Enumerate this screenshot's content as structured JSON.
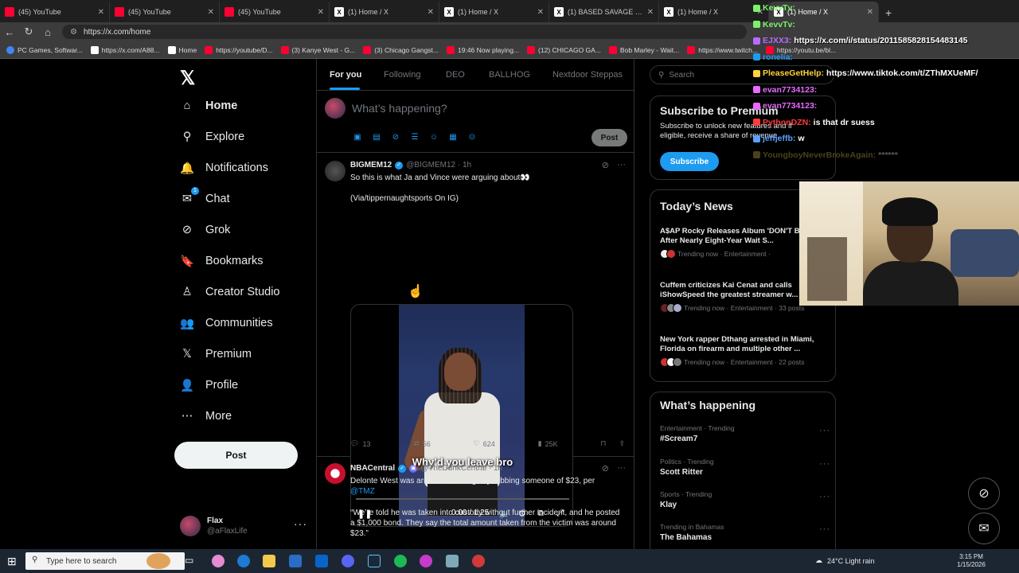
{
  "browser": {
    "tabs": [
      {
        "title": "(45) YouTube",
        "type": "yt"
      },
      {
        "title": "(45) YouTube",
        "type": "yt"
      },
      {
        "title": "(45) YouTube",
        "type": "yt"
      },
      {
        "title": "(1) Home / X",
        "type": "x"
      },
      {
        "title": "(1) Home / X",
        "type": "x"
      },
      {
        "title": "(1) BASED SAVAGE on X: \"T",
        "type": "x"
      },
      {
        "title": "(1) Home / X",
        "type": "x"
      },
      {
        "title": "(1) Home / X",
        "type": "x"
      }
    ],
    "url": "https://x.com/home",
    "bookmarks": [
      "PC Games, Softwar...",
      "https://x.com/A88...",
      "Home",
      "https://youtube/D...",
      "(3) Kanye West - G...",
      "(3) Chicago Gangst...",
      "19:46 Now playing...",
      "(12) CHICAGO GA...",
      "Bob Marley - Wait...",
      "https://www.twitch...",
      "https://youtu.be/bl..."
    ]
  },
  "nav": {
    "items": [
      {
        "label": "Home",
        "icon": "home-icon",
        "glyph": "⌂"
      },
      {
        "label": "Explore",
        "icon": "search-icon",
        "glyph": "⚲"
      },
      {
        "label": "Notifications",
        "icon": "bell-icon",
        "glyph": "🔔"
      },
      {
        "label": "Chat",
        "icon": "mail-icon",
        "glyph": "✉",
        "badge": "1"
      },
      {
        "label": "Grok",
        "icon": "grok-icon",
        "glyph": "⊘"
      },
      {
        "label": "Bookmarks",
        "icon": "bookmark-icon",
        "glyph": "🔖"
      },
      {
        "label": "Creator Studio",
        "icon": "creator-icon",
        "glyph": "♙"
      },
      {
        "label": "Communities",
        "icon": "communities-icon",
        "glyph": "👥"
      },
      {
        "label": "Premium",
        "icon": "x-premium-icon",
        "glyph": "𝕏"
      },
      {
        "label": "Profile",
        "icon": "profile-icon",
        "glyph": "👤"
      },
      {
        "label": "More",
        "icon": "more-icon",
        "glyph": "⋯"
      }
    ],
    "post_label": "Post",
    "account": {
      "name": "Flax",
      "handle": "@aFlaxLife"
    }
  },
  "feed": {
    "tabs": [
      "For you",
      "Following",
      "DEO",
      "BALLHOG",
      "Nextdoor Steppas"
    ],
    "compose_placeholder": "What’s happening?",
    "compose_post_label": "Post",
    "tweets": [
      {
        "name": "BIGMEM12",
        "handle": "@BIGMEM12 · 1h",
        "text": "So this is what Ja and Vince were arguing about👀",
        "text2": "(Via/tippernaughtsports On IG)",
        "video": {
          "caption": "Why’d you leave bro",
          "time": "0:00 / 1:25",
          "progress": 0.0
        },
        "stats": {
          "replies": "13",
          "reposts": "56",
          "likes": "624",
          "views": "25K"
        }
      },
      {
        "name": "NBACentral",
        "handle": "@TheDunkCentral · 1h",
        "text": "Delonte West was arrested for allegedly robbing someone of $23, per",
        "mention": "@TMZ",
        "text2": "“We’re told he was taken into custody without further incident, and he posted a $1,000 bond. They say the total amount taken from the victim was around $23.”"
      }
    ]
  },
  "sidebar": {
    "search_placeholder": "Search",
    "premium": {
      "title": "Subscribe to Premium",
      "text": "Subscribe to unlock new features and if eligible, receive a share of revenue.",
      "button": "Subscribe"
    },
    "news": {
      "title": "Today’s News",
      "items": [
        {
          "title": "A$AP Rocky Releases Album 'DON'T BE DUMB' After Nearly Eight-Year Wait S...",
          "meta": "Trending now · Entertainment ·"
        },
        {
          "title": "Cuffem criticizes Kai Cenat and calls iShowSpeed the greatest streamer w...",
          "meta": "Trending now · Entertainment · 33 posts"
        },
        {
          "title": "New York rapper Dthang arrested in Miami, Florida on firearm and multiple other ...",
          "meta": "Trending now · Entertainment · 22 posts"
        }
      ]
    },
    "happening": {
      "title": "What’s happening",
      "trends": [
        {
          "cat": "Entertainment · Trending",
          "name": "#Scream7"
        },
        {
          "cat": "Politics · Trending",
          "name": "Scott Ritter"
        },
        {
          "cat": "Sports · Trending",
          "name": "Klay"
        },
        {
          "cat": "Trending in Bahamas",
          "name": "The Bahamas"
        }
      ]
    }
  },
  "stream_chat": [
    {
      "user": "KevvTv:",
      "msg": "",
      "color": "#7cf06b",
      "faded": false
    },
    {
      "user": "KevvTv:",
      "msg": "",
      "color": "#7cf06b",
      "faded": false
    },
    {
      "user": "EJXX3:",
      "msg": "https://x.com/i/status/2011585828154483145",
      "color": "#b86bff",
      "faded": false
    },
    {
      "user": "ronelia:",
      "msg": "",
      "color": "#1d9bf0",
      "faded": false
    },
    {
      "user": "PleaseGetHelp:",
      "msg": "https://www.tiktok.com/t/ZThMXUeMF/",
      "color": "#ffd23f",
      "faded": false
    },
    {
      "user": "evan7734123:",
      "msg": "",
      "color": "#e86bff",
      "faded": false
    },
    {
      "user": "evan7734123:",
      "msg": "",
      "color": "#e86bff",
      "faded": false
    },
    {
      "user": "PythonDZN:",
      "msg": "is that dr suess",
      "color": "#ff3b3b",
      "faded": false
    },
    {
      "user": "jeffjeffb:",
      "msg": "w",
      "color": "#5aa0ff",
      "faded": false
    },
    {
      "user": "YoungboyNeverBrokeAgain:",
      "msg": "******",
      "color": "#d8b84a",
      "faded": true
    }
  ],
  "taskbar": {
    "search_placeholder": "Type here to search",
    "weather": "24°C  Light rain",
    "time": "3:15 PM",
    "date": "1/15/2026"
  },
  "colors": {
    "accent": "#1d9bf0",
    "bg": "#000000",
    "border": "#2f3336",
    "muted": "#71767b"
  }
}
